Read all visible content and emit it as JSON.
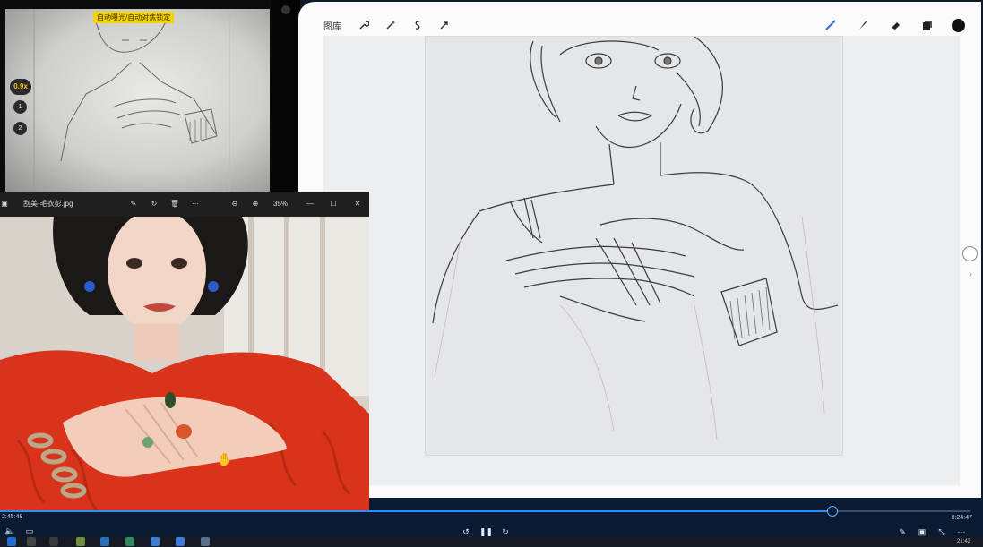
{
  "camera": {
    "banner": "自动曝光/自动对焦锁定",
    "zoom": "0.9x",
    "lens_1": "1",
    "lens_2": "2"
  },
  "procreate": {
    "gallery_label": "图库",
    "tools_left": [
      "wrench-icon",
      "magic-wand-icon",
      "selection-icon",
      "transform-icon"
    ],
    "tools_right": [
      "brush-icon",
      "smudge-icon",
      "eraser-icon",
      "layers-icon"
    ],
    "current_color": "#111111"
  },
  "viewer": {
    "filename": "刮美-毛衣彭.jpg",
    "zoom": "35%",
    "minimize": "—",
    "maximize": "☐",
    "close": "✕"
  },
  "player": {
    "current_time": "0:24:47",
    "left_time": "2:45:48",
    "progress_percent": 77
  },
  "taskbar": {
    "time": "21:42"
  },
  "colors": {
    "player_bg": "#0b1a33",
    "progress_accent": "#2f8cff",
    "camera_banner": "#f2d400",
    "sweater_red": "#d9341b"
  }
}
